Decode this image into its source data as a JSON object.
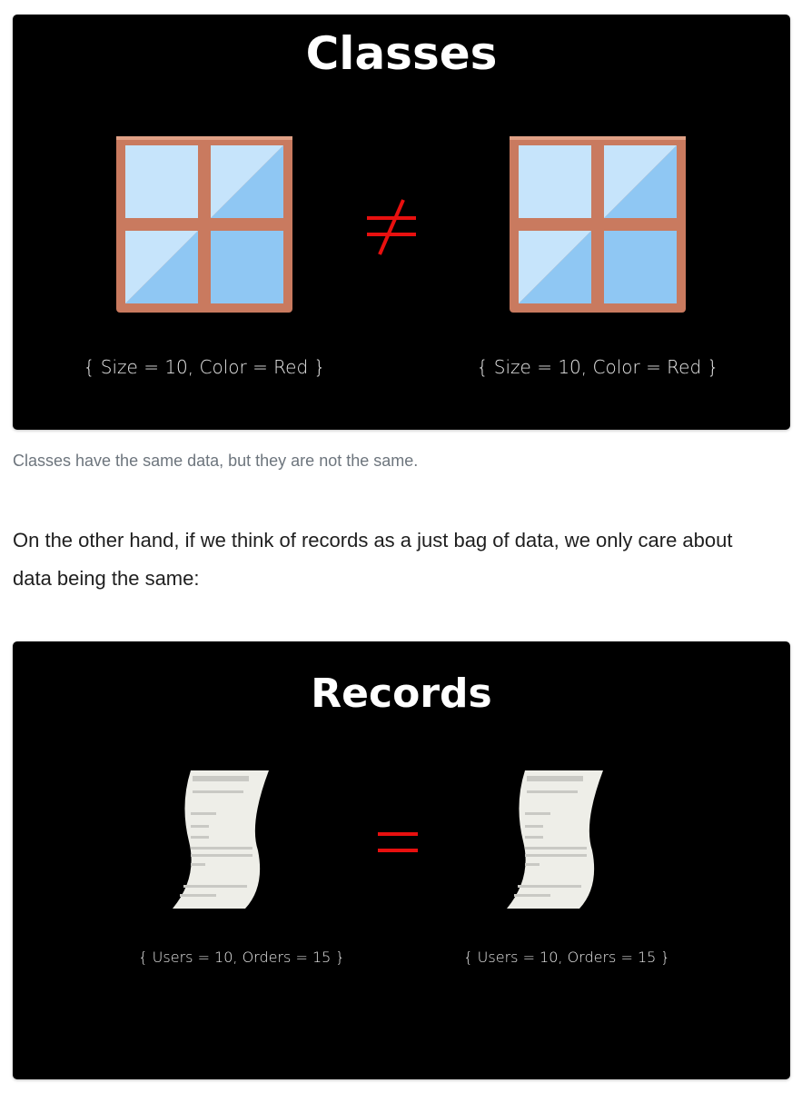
{
  "classes_panel": {
    "title": "Classes",
    "relation_symbol": "≠",
    "left_label": "{ Size = 10, Color = Red }",
    "right_label": "{ Size = 10, Color = Red }",
    "icon": "window-icon",
    "relation_color": "#e8100f"
  },
  "caption": "Classes have the same data, but they are not the same.",
  "paragraph": "On the other hand, if we think of records as a just bag of data, we only care about data being the same:",
  "records_panel": {
    "title": "Records",
    "relation_symbol": "=",
    "left_label": "{ Users = 10, Orders = 15 }",
    "right_label": "{ Users = 10, Orders = 15 }",
    "icon": "receipt-icon",
    "relation_color": "#e8100f"
  }
}
